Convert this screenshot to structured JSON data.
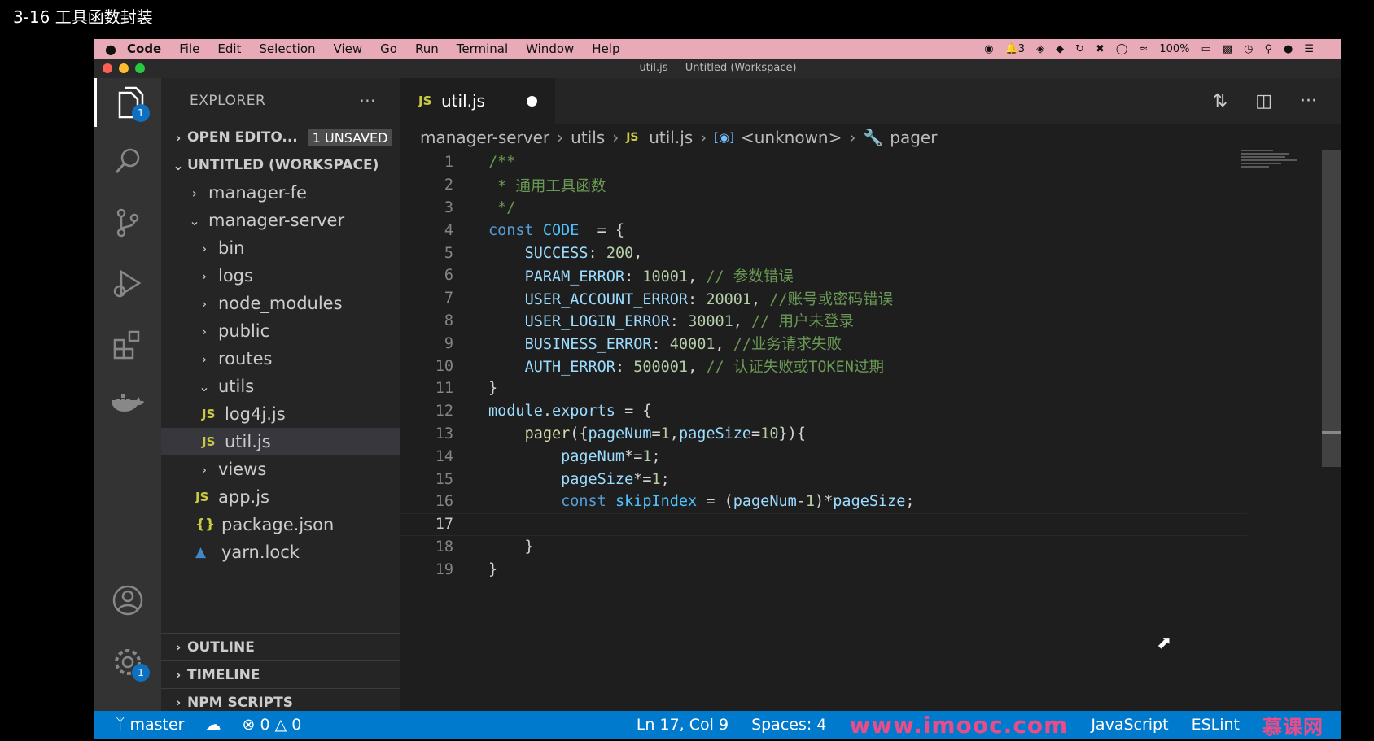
{
  "video": {
    "title": "3-16 工具函数封装"
  },
  "menubar": {
    "apple": "",
    "items": [
      "Code",
      "File",
      "Edit",
      "Selection",
      "View",
      "Go",
      "Run",
      "Terminal",
      "Window",
      "Help"
    ],
    "tray": {
      "notification_count": "3",
      "battery": "100%"
    }
  },
  "window": {
    "title": "util.js — Untitled (Workspace)"
  },
  "activity": {
    "explorer_badge": "1",
    "settings_badge": "1"
  },
  "sidebar": {
    "title": "EXPLORER",
    "more": "···",
    "open_editors": {
      "label": "OPEN EDITO...",
      "badge": "1 UNSAVED"
    },
    "workspace": "UNTITLED (WORKSPACE)",
    "tree": [
      {
        "label": "manager-fe",
        "type": "folder",
        "open": false,
        "depth": 1
      },
      {
        "label": "manager-server",
        "type": "folder",
        "open": true,
        "depth": 1
      },
      {
        "label": "bin",
        "type": "folder",
        "open": false,
        "depth": 2
      },
      {
        "label": "logs",
        "type": "folder",
        "open": false,
        "depth": 2
      },
      {
        "label": "node_modules",
        "type": "folder",
        "open": false,
        "depth": 2
      },
      {
        "label": "public",
        "type": "folder",
        "open": false,
        "depth": 2
      },
      {
        "label": "routes",
        "type": "folder",
        "open": false,
        "depth": 2
      },
      {
        "label": "utils",
        "type": "folder",
        "open": true,
        "depth": 2
      },
      {
        "label": "log4j.js",
        "type": "js",
        "depth": 3
      },
      {
        "label": "util.js",
        "type": "js",
        "depth": 3,
        "selected": true
      },
      {
        "label": "views",
        "type": "folder",
        "open": false,
        "depth": 2
      },
      {
        "label": "app.js",
        "type": "js",
        "depth": 2
      },
      {
        "label": "package.json",
        "type": "json",
        "depth": 2
      },
      {
        "label": "yarn.lock",
        "type": "yarn",
        "depth": 2
      }
    ],
    "outline": "OUTLINE",
    "timeline": "TIMELINE",
    "npm_scripts": "NPM SCRIPTS"
  },
  "editor": {
    "tab": {
      "icon": "JS",
      "label": "util.js"
    },
    "breadcrumb": [
      "manager-server",
      "utils",
      "util.js",
      "<unknown>",
      "pager"
    ],
    "current_line": 17,
    "lines": [
      "/**",
      " * 通用工具函数",
      " */",
      "const CODE  = {",
      "    SUCCESS: 200,",
      "    PARAM_ERROR: 10001, // 参数错误",
      "    USER_ACCOUNT_ERROR: 20001, //账号或密码错误",
      "    USER_LOGIN_ERROR: 30001, // 用户未登录",
      "    BUSINESS_ERROR: 40001, //业务请求失败",
      "    AUTH_ERROR: 500001, // 认证失败或TOKEN过期",
      "}",
      "module.exports = {",
      "    pager({pageNum=1,pageSize=10}){",
      "        pageNum*=1;",
      "        pageSize*=1;",
      "        const skipIndex = (pageNum-1)*pageSize;",
      "",
      "    }",
      "}"
    ]
  },
  "statusbar": {
    "branch": "master",
    "errors": "0",
    "warnings": "0",
    "position": "Ln 17, Col 9",
    "spaces": "Spaces: 4",
    "language": "JavaScript",
    "eslint": "ESLint",
    "watermark": "www.imooc.com",
    "watermark_cn": "慕课网"
  },
  "colors": {
    "status_bar": "#007acc",
    "menubar": "#e8aab7",
    "watermark": "#e94c89"
  },
  "icons": {
    "explorer": "files-icon",
    "search": "search-icon",
    "scm": "source-control-icon",
    "debug": "run-debug-icon",
    "extensions": "extensions-icon",
    "docker": "docker-icon",
    "account": "account-icon",
    "settings": "gear-icon"
  }
}
